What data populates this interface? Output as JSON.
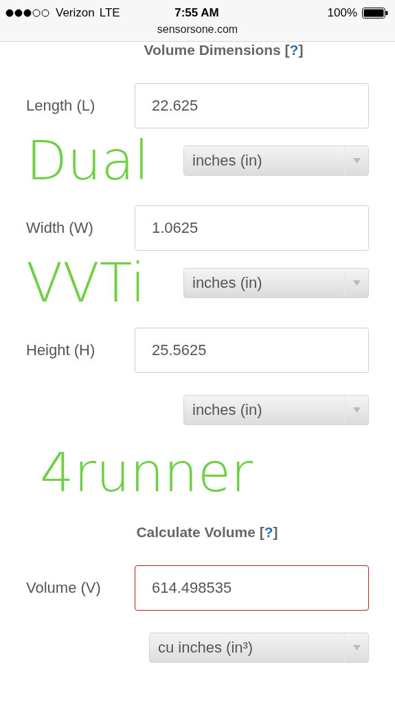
{
  "status_bar": {
    "carrier": "Verizon",
    "network": "LTE",
    "time": "7:55 AM",
    "battery": "100%"
  },
  "url": "sensorsone.com",
  "sections": [
    {
      "title": "Volume Dimensions",
      "help": {
        "open": "[",
        "link": "?",
        "close": "]"
      },
      "fields": [
        {
          "label": "Length (L)",
          "value": "22.625",
          "unit": "inches (in)",
          "highlighted": false,
          "annotation": "Dual"
        },
        {
          "label": "Width (W)",
          "value": "1.0625",
          "unit": "inches (in)",
          "highlighted": false,
          "annotation": "VVTi"
        },
        {
          "label": "Height (H)",
          "value": "25.5625",
          "unit": "inches (in)",
          "highlighted": false
        }
      ],
      "annotation": "4runner"
    },
    {
      "title": "Calculate Volume",
      "help": {
        "open": "[",
        "link": "?",
        "close": "]"
      },
      "fields": [
        {
          "label": "Volume (V)",
          "value": "614.498535",
          "unit": "cu inches (in³)",
          "highlighted": true,
          "wide": true
        }
      ]
    }
  ]
}
